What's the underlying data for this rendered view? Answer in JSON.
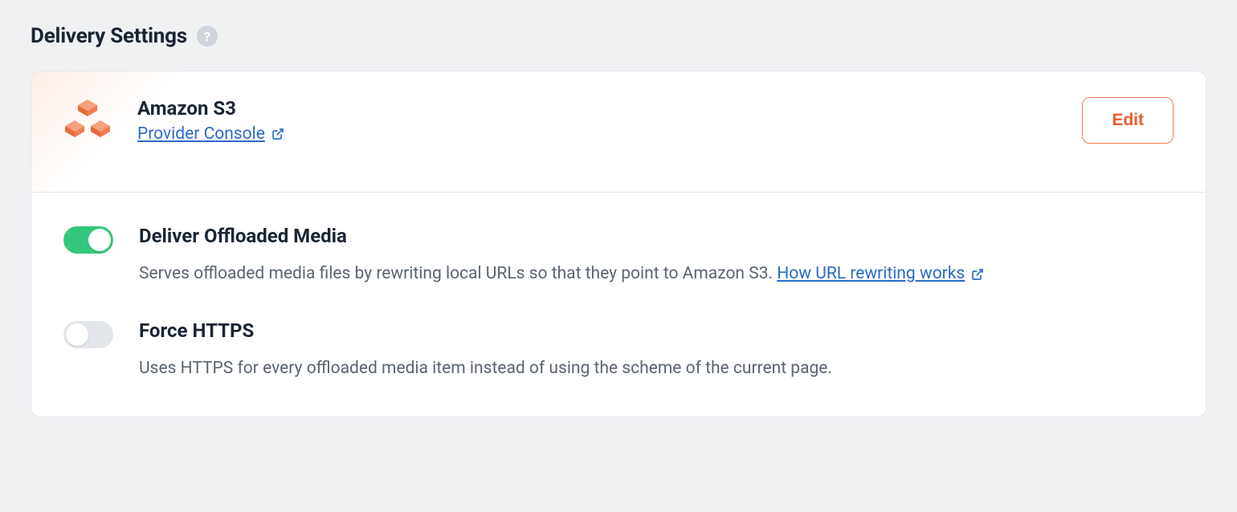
{
  "section": {
    "title": "Delivery Settings",
    "help_label": "?"
  },
  "provider": {
    "name": "Amazon S3",
    "console_link_label": "Provider Console",
    "icon": "s3-boxes-icon",
    "edit_label": "Edit"
  },
  "settings": [
    {
      "toggle_on": true,
      "title": "Deliver Offloaded Media",
      "description_prefix": "Serves offloaded media files by rewriting local URLs so that they point to Amazon S3. ",
      "link_label": "How URL rewriting works"
    },
    {
      "toggle_on": false,
      "title": "Force HTTPS",
      "description_prefix": "Uses HTTPS for every offloaded media item instead of using the scheme of the current page.",
      "link_label": ""
    }
  ]
}
